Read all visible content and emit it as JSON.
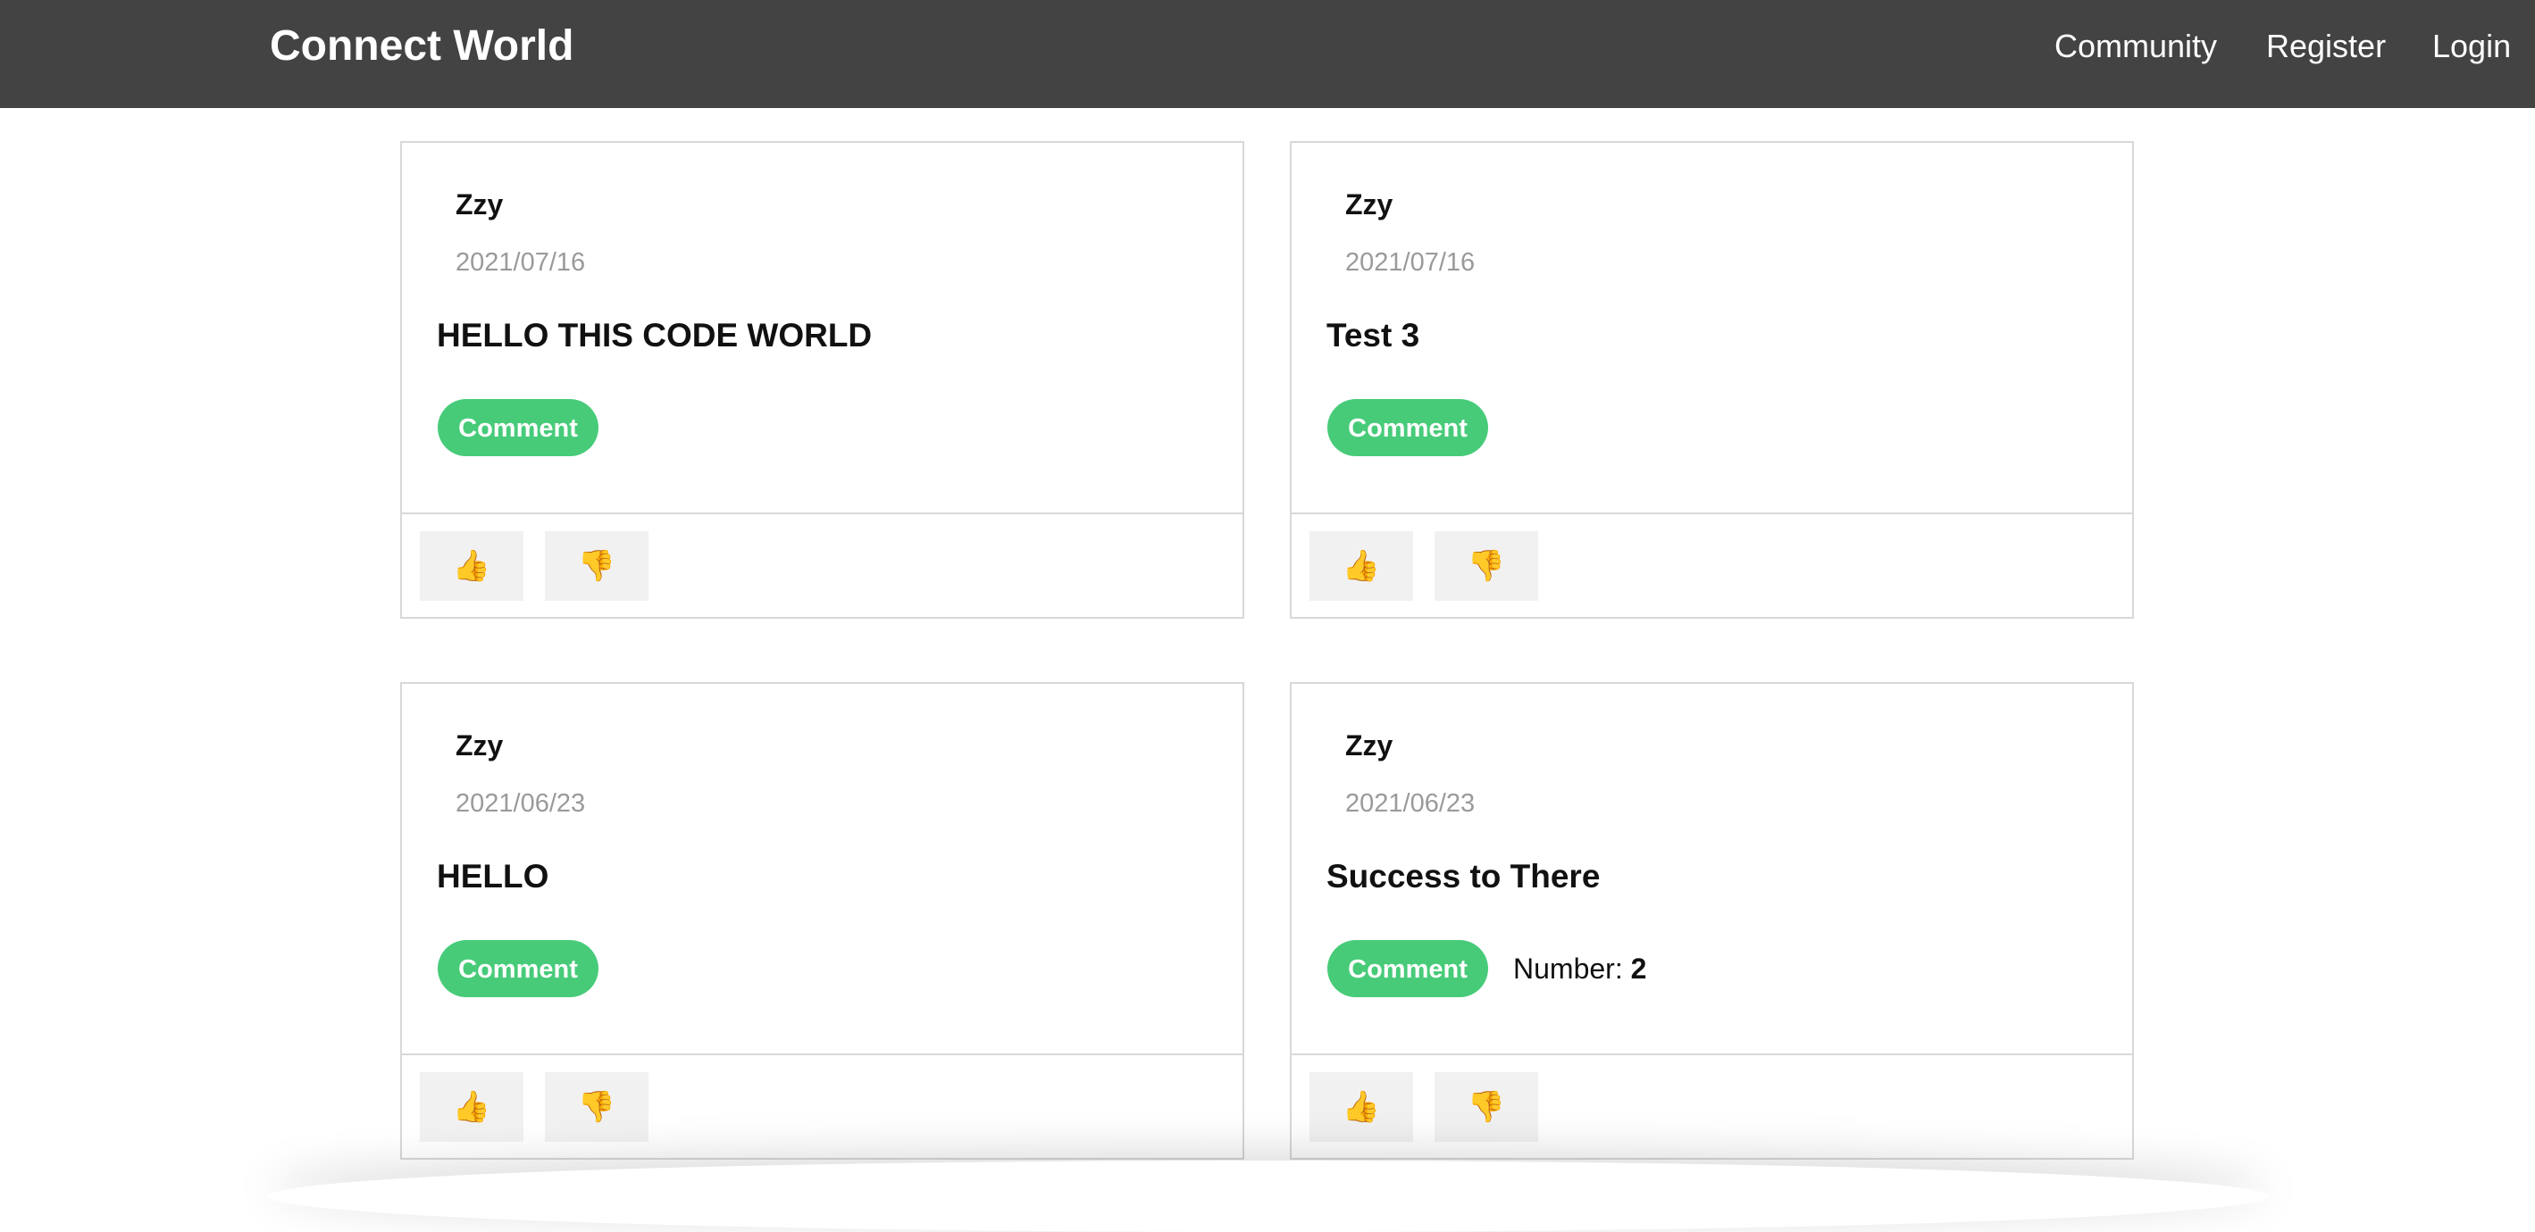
{
  "header": {
    "brand": "Connect World",
    "nav": {
      "community": "Community",
      "register": "Register",
      "login": "Login"
    },
    "background_color": "#434343"
  },
  "accent_color": "#47cb79",
  "posts": [
    {
      "author": "Zzy",
      "date": "2021/07/16",
      "title": "HELLO THIS CODE WORLD",
      "comment_label": "Comment",
      "like_icon": "👍",
      "dislike_icon": "👎"
    },
    {
      "author": "Zzy",
      "date": "2021/07/16",
      "title": "Test 3",
      "comment_label": "Comment",
      "like_icon": "👍",
      "dislike_icon": "👎"
    },
    {
      "author": "Zzy",
      "date": "2021/06/23",
      "title": "HELLO",
      "comment_label": "Comment",
      "like_icon": "👍",
      "dislike_icon": "👎"
    },
    {
      "author": "Zzy",
      "date": "2021/06/23",
      "title": "Success to There",
      "comment_label": "Comment",
      "number_label": "Number:",
      "number_value": "2",
      "like_icon": "👍",
      "dislike_icon": "👎"
    }
  ]
}
